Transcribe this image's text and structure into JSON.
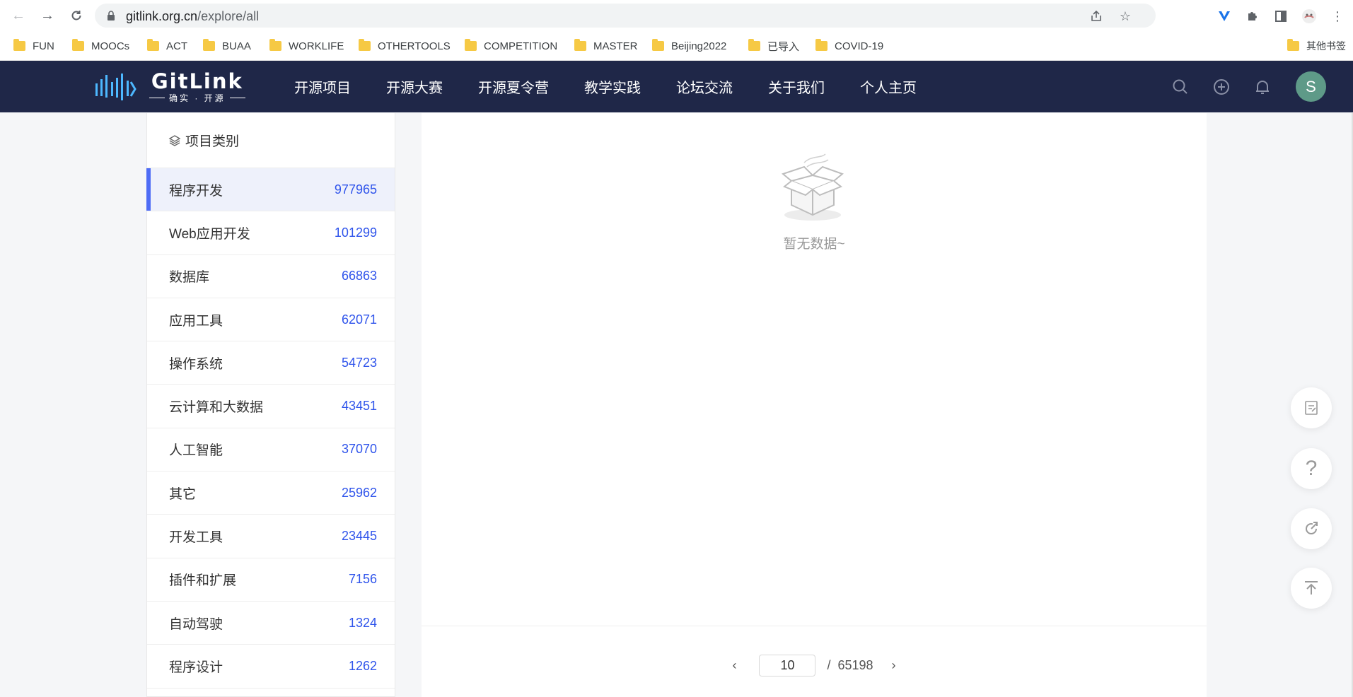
{
  "browser": {
    "url_domain": "gitlink.org.cn",
    "url_path": "/explore/all",
    "bookmarks": [
      "FUN",
      "MOOCs",
      "ACT",
      "BUAA",
      "WORKLIFE",
      "OTHERTOOLS",
      "COMPETITION",
      "MASTER",
      "Beijing2022",
      "已导入",
      "COVID-19"
    ],
    "other_bookmarks": "其他书签"
  },
  "header": {
    "logo_word": "GitLink",
    "logo_tagline": "确实 · 开源",
    "nav": [
      "开源项目",
      "开源大赛",
      "开源夏令营",
      "教学实践",
      "论坛交流",
      "关于我们",
      "个人主页"
    ],
    "avatar_initial": "S",
    "brand_color": "#1f2748"
  },
  "sidebar": {
    "title": "项目类别",
    "categories": [
      {
        "name": "程序开发",
        "count": "977965"
      },
      {
        "name": "Web应用开发",
        "count": "101299"
      },
      {
        "name": "数据库",
        "count": "66863"
      },
      {
        "name": "应用工具",
        "count": "62071"
      },
      {
        "name": "操作系统",
        "count": "54723"
      },
      {
        "name": "云计算和大数据",
        "count": "43451"
      },
      {
        "name": "人工智能",
        "count": "37070"
      },
      {
        "name": "其它",
        "count": "25962"
      },
      {
        "name": "开发工具",
        "count": "23445"
      },
      {
        "name": "插件和扩展",
        "count": "7156"
      },
      {
        "name": "自动驾驶",
        "count": "1324"
      },
      {
        "name": "程序设计",
        "count": "1262"
      }
    ],
    "active_index": 0,
    "accent_color": "#4e6cf5"
  },
  "main": {
    "empty_text": "暂无数据~",
    "pagination": {
      "current_page": "10",
      "separator": "/",
      "total_pages": "65198"
    }
  }
}
